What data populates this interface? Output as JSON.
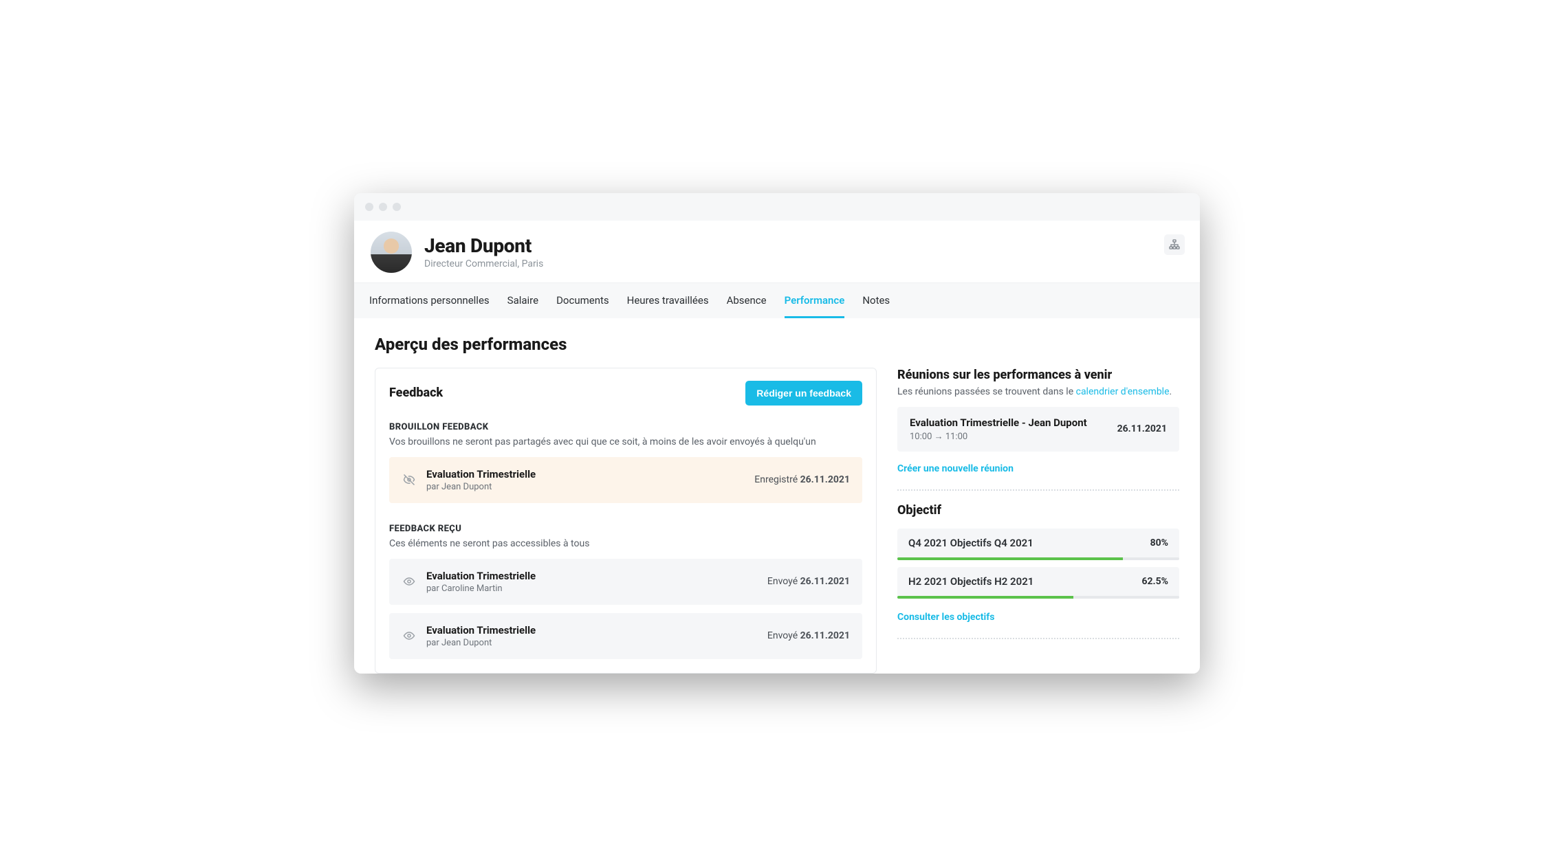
{
  "person": {
    "name": "Jean Dupont",
    "subtitle": "Directeur Commercial, Paris"
  },
  "tabs": [
    "Informations personnelles",
    "Salaire",
    "Documents",
    "Heures travaillées",
    "Absence",
    "Performance",
    "Notes"
  ],
  "active_tab_index": 5,
  "page_title": "Aperçu des performances",
  "feedback": {
    "title": "Feedback",
    "compose_button": "Rédiger un feedback",
    "draft_section": {
      "label": "BROUILLON FEEDBACK",
      "desc": "Vos brouillons ne seront pas partagés avec qui que ce soit, à moins de les avoir envoyés à quelqu'un",
      "items": [
        {
          "title": "Evaluation Trimestrielle",
          "author": "par Jean Dupont",
          "status_prefix": "Enregistré ",
          "date": "26.11.2021"
        }
      ]
    },
    "received_section": {
      "label": "FEEDBACK REÇU",
      "desc": "Ces éléments ne seront pas accessibles à tous",
      "items": [
        {
          "title": "Evaluation Trimestrielle",
          "author": "par Caroline Martin",
          "status_prefix": "Envoyé ",
          "date": "26.11.2021"
        },
        {
          "title": "Evaluation Trimestrielle",
          "author": "par Jean Dupont",
          "status_prefix": "Envoyé ",
          "date": "26.11.2021"
        }
      ]
    }
  },
  "meetings": {
    "title": "Réunions sur les performances à venir",
    "desc_prefix": "Les réunions passées se trouvent dans le ",
    "desc_link": "calendrier d'ensemble",
    "desc_suffix": ".",
    "item": {
      "title": "Evaluation Trimestrielle - Jean Dupont",
      "time": "10:00 → 11:00",
      "date": "26.11.2021"
    },
    "create_link": "Créer une nouvelle réunion"
  },
  "goals": {
    "title": "Objectif",
    "items": [
      {
        "label": "Q4 2021 Objectifs Q4 2021",
        "pct_text": "80%",
        "pct": 80
      },
      {
        "label": "H2 2021 Objectifs H2 2021",
        "pct_text": "62.5%",
        "pct": 62.5
      }
    ],
    "view_link": "Consulter les objectifs"
  }
}
